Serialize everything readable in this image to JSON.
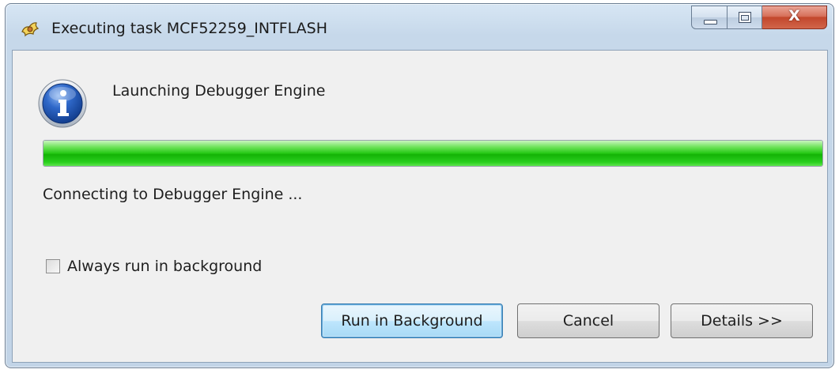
{
  "window": {
    "title": "Executing task MCF52259_INTFLASH",
    "app_icon": "eclipse-sun-icon",
    "caption": {
      "minimize_icon": "minimize-icon",
      "maximize_icon": "maximize-icon",
      "close_icon": "close-icon",
      "close_glyph": "X"
    }
  },
  "dialog": {
    "info_icon": "info-icon",
    "task_name": "Launching Debugger Engine",
    "progress": {
      "percent": 100,
      "color": "#25c815"
    },
    "status_text": "Connecting to Debugger Engine ...",
    "always_background": {
      "label": "Always run in background",
      "checked": false
    },
    "buttons": {
      "run_background": "Run in Background",
      "cancel": "Cancel",
      "details": "Details >>"
    }
  },
  "colors": {
    "default_button_border": "#3c7fb1",
    "close_button": "#c2472c"
  }
}
